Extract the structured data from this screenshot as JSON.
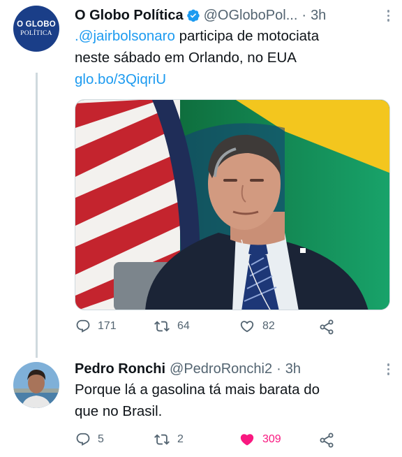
{
  "tweet1": {
    "avatar_line1": "O GLOBO",
    "avatar_line2": "POLÍTICA",
    "display_name": "O Globo Política",
    "handle": "@OGloboPol...",
    "dot": "·",
    "time": "3h",
    "mention": ".@jairbolsonaro",
    "text_rest": "participa de motociata",
    "text_line2": "neste sábado em Orlando, no EUA",
    "link": "glo.bo/3QiqriU",
    "replies": "171",
    "retweets": "64",
    "likes": "82"
  },
  "tweet2": {
    "display_name": "Pedro Ronchi",
    "handle": "@PedroRonchi2",
    "dot": "·",
    "time": "3h",
    "text_line1": "Porque lá a gasolina tá mais barata do",
    "text_line2": "que no Brasil.",
    "replies": "5",
    "retweets": "2",
    "likes": "309"
  },
  "colors": {
    "link_blue": "#1d9bf0",
    "like_pink": "#f91880",
    "muted_gray": "#536471",
    "logo_navy": "#1a3e88"
  },
  "icons": [
    "verified-badge-icon",
    "more-icon",
    "reply-icon",
    "retweet-icon",
    "like-icon",
    "share-icon"
  ]
}
